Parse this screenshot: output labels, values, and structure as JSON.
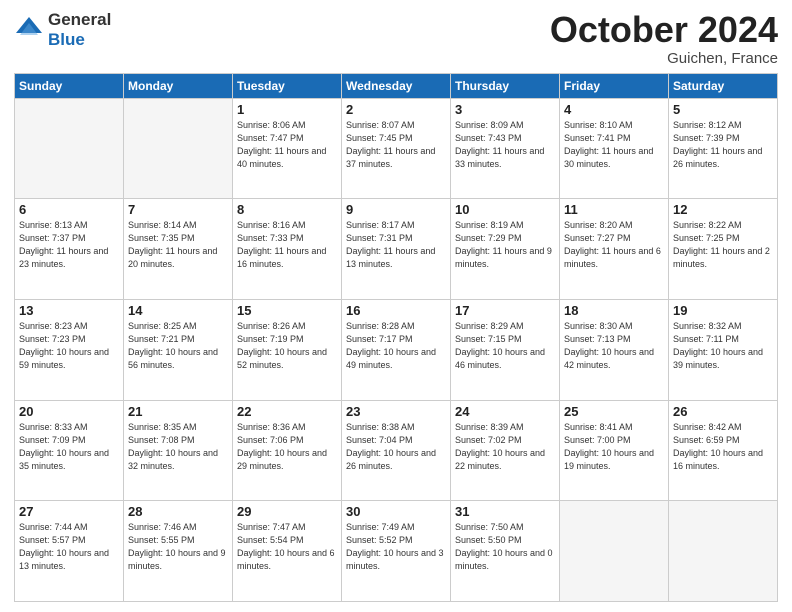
{
  "header": {
    "logo_general": "General",
    "logo_blue": "Blue",
    "month_title": "October 2024",
    "location": "Guichen, France"
  },
  "days_of_week": [
    "Sunday",
    "Monday",
    "Tuesday",
    "Wednesday",
    "Thursday",
    "Friday",
    "Saturday"
  ],
  "weeks": [
    [
      {
        "day": "",
        "info": ""
      },
      {
        "day": "",
        "info": ""
      },
      {
        "day": "1",
        "sunrise": "Sunrise: 8:06 AM",
        "sunset": "Sunset: 7:47 PM",
        "daylight": "Daylight: 11 hours and 40 minutes."
      },
      {
        "day": "2",
        "sunrise": "Sunrise: 8:07 AM",
        "sunset": "Sunset: 7:45 PM",
        "daylight": "Daylight: 11 hours and 37 minutes."
      },
      {
        "day": "3",
        "sunrise": "Sunrise: 8:09 AM",
        "sunset": "Sunset: 7:43 PM",
        "daylight": "Daylight: 11 hours and 33 minutes."
      },
      {
        "day": "4",
        "sunrise": "Sunrise: 8:10 AM",
        "sunset": "Sunset: 7:41 PM",
        "daylight": "Daylight: 11 hours and 30 minutes."
      },
      {
        "day": "5",
        "sunrise": "Sunrise: 8:12 AM",
        "sunset": "Sunset: 7:39 PM",
        "daylight": "Daylight: 11 hours and 26 minutes."
      }
    ],
    [
      {
        "day": "6",
        "sunrise": "Sunrise: 8:13 AM",
        "sunset": "Sunset: 7:37 PM",
        "daylight": "Daylight: 11 hours and 23 minutes."
      },
      {
        "day": "7",
        "sunrise": "Sunrise: 8:14 AM",
        "sunset": "Sunset: 7:35 PM",
        "daylight": "Daylight: 11 hours and 20 minutes."
      },
      {
        "day": "8",
        "sunrise": "Sunrise: 8:16 AM",
        "sunset": "Sunset: 7:33 PM",
        "daylight": "Daylight: 11 hours and 16 minutes."
      },
      {
        "day": "9",
        "sunrise": "Sunrise: 8:17 AM",
        "sunset": "Sunset: 7:31 PM",
        "daylight": "Daylight: 11 hours and 13 minutes."
      },
      {
        "day": "10",
        "sunrise": "Sunrise: 8:19 AM",
        "sunset": "Sunset: 7:29 PM",
        "daylight": "Daylight: 11 hours and 9 minutes."
      },
      {
        "day": "11",
        "sunrise": "Sunrise: 8:20 AM",
        "sunset": "Sunset: 7:27 PM",
        "daylight": "Daylight: 11 hours and 6 minutes."
      },
      {
        "day": "12",
        "sunrise": "Sunrise: 8:22 AM",
        "sunset": "Sunset: 7:25 PM",
        "daylight": "Daylight: 11 hours and 2 minutes."
      }
    ],
    [
      {
        "day": "13",
        "sunrise": "Sunrise: 8:23 AM",
        "sunset": "Sunset: 7:23 PM",
        "daylight": "Daylight: 10 hours and 59 minutes."
      },
      {
        "day": "14",
        "sunrise": "Sunrise: 8:25 AM",
        "sunset": "Sunset: 7:21 PM",
        "daylight": "Daylight: 10 hours and 56 minutes."
      },
      {
        "day": "15",
        "sunrise": "Sunrise: 8:26 AM",
        "sunset": "Sunset: 7:19 PM",
        "daylight": "Daylight: 10 hours and 52 minutes."
      },
      {
        "day": "16",
        "sunrise": "Sunrise: 8:28 AM",
        "sunset": "Sunset: 7:17 PM",
        "daylight": "Daylight: 10 hours and 49 minutes."
      },
      {
        "day": "17",
        "sunrise": "Sunrise: 8:29 AM",
        "sunset": "Sunset: 7:15 PM",
        "daylight": "Daylight: 10 hours and 46 minutes."
      },
      {
        "day": "18",
        "sunrise": "Sunrise: 8:30 AM",
        "sunset": "Sunset: 7:13 PM",
        "daylight": "Daylight: 10 hours and 42 minutes."
      },
      {
        "day": "19",
        "sunrise": "Sunrise: 8:32 AM",
        "sunset": "Sunset: 7:11 PM",
        "daylight": "Daylight: 10 hours and 39 minutes."
      }
    ],
    [
      {
        "day": "20",
        "sunrise": "Sunrise: 8:33 AM",
        "sunset": "Sunset: 7:09 PM",
        "daylight": "Daylight: 10 hours and 35 minutes."
      },
      {
        "day": "21",
        "sunrise": "Sunrise: 8:35 AM",
        "sunset": "Sunset: 7:08 PM",
        "daylight": "Daylight: 10 hours and 32 minutes."
      },
      {
        "day": "22",
        "sunrise": "Sunrise: 8:36 AM",
        "sunset": "Sunset: 7:06 PM",
        "daylight": "Daylight: 10 hours and 29 minutes."
      },
      {
        "day": "23",
        "sunrise": "Sunrise: 8:38 AM",
        "sunset": "Sunset: 7:04 PM",
        "daylight": "Daylight: 10 hours and 26 minutes."
      },
      {
        "day": "24",
        "sunrise": "Sunrise: 8:39 AM",
        "sunset": "Sunset: 7:02 PM",
        "daylight": "Daylight: 10 hours and 22 minutes."
      },
      {
        "day": "25",
        "sunrise": "Sunrise: 8:41 AM",
        "sunset": "Sunset: 7:00 PM",
        "daylight": "Daylight: 10 hours and 19 minutes."
      },
      {
        "day": "26",
        "sunrise": "Sunrise: 8:42 AM",
        "sunset": "Sunset: 6:59 PM",
        "daylight": "Daylight: 10 hours and 16 minutes."
      }
    ],
    [
      {
        "day": "27",
        "sunrise": "Sunrise: 7:44 AM",
        "sunset": "Sunset: 5:57 PM",
        "daylight": "Daylight: 10 hours and 13 minutes."
      },
      {
        "day": "28",
        "sunrise": "Sunrise: 7:46 AM",
        "sunset": "Sunset: 5:55 PM",
        "daylight": "Daylight: 10 hours and 9 minutes."
      },
      {
        "day": "29",
        "sunrise": "Sunrise: 7:47 AM",
        "sunset": "Sunset: 5:54 PM",
        "daylight": "Daylight: 10 hours and 6 minutes."
      },
      {
        "day": "30",
        "sunrise": "Sunrise: 7:49 AM",
        "sunset": "Sunset: 5:52 PM",
        "daylight": "Daylight: 10 hours and 3 minutes."
      },
      {
        "day": "31",
        "sunrise": "Sunrise: 7:50 AM",
        "sunset": "Sunset: 5:50 PM",
        "daylight": "Daylight: 10 hours and 0 minutes."
      },
      {
        "day": "",
        "info": ""
      },
      {
        "day": "",
        "info": ""
      }
    ]
  ]
}
